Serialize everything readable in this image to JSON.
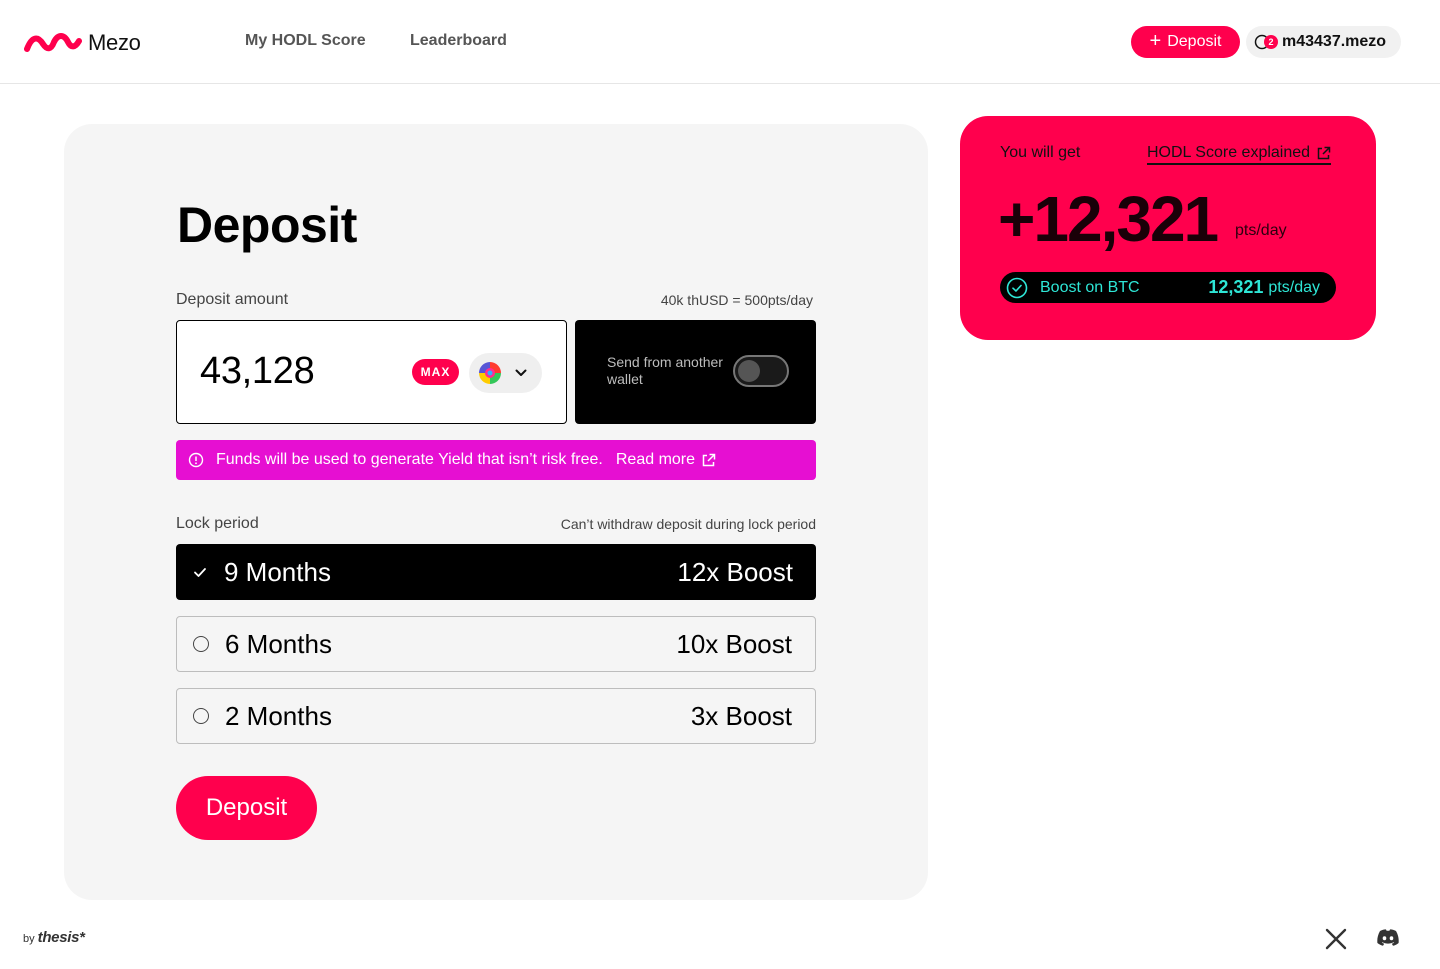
{
  "header": {
    "brand": "Mezo",
    "nav": [
      "My HODL Score",
      "Leaderboard"
    ],
    "deposit_label": "Deposit",
    "account_badge": "2",
    "account_name": "m43437.mezo"
  },
  "deposit": {
    "title": "Deposit",
    "amount_label": "Deposit amount",
    "rate_note": "40k thUSD = 500pts/day",
    "amount_value": "43,128",
    "max_label": "MAX",
    "token_icon": "rainbow-token-icon",
    "wallet_toggle_label": "Send from another wallet",
    "wallet_toggle_on": false,
    "notice_text": "Funds will be used to generate Yield that isn’t risk free.",
    "notice_link": "Read more",
    "lock_label": "Lock period",
    "lock_note": "Can’t withdraw deposit during lock period",
    "lock_options": [
      {
        "name": "9 Months",
        "boost": "12x Boost",
        "selected": true
      },
      {
        "name": "6 Months",
        "boost": "10x Boost",
        "selected": false
      },
      {
        "name": "2 Months",
        "boost": "3x Boost",
        "selected": false
      }
    ],
    "submit_label": "Deposit"
  },
  "summary": {
    "you_get": "You will get",
    "explained_link": "HODL Score explained",
    "points": "+12,321",
    "points_unit": "pts/day",
    "boost_label": "Boost on BTC",
    "boost_value": "12,321",
    "boost_unit": "pts/day"
  },
  "footer": {
    "by": "by",
    "company": "thesis*",
    "social": [
      "x-icon",
      "discord-icon"
    ]
  },
  "colors": {
    "accent": "#ff004d",
    "notice": "#e60fd2",
    "boost_text": "#2ee6d6",
    "card_bg": "#f5f5f5"
  }
}
